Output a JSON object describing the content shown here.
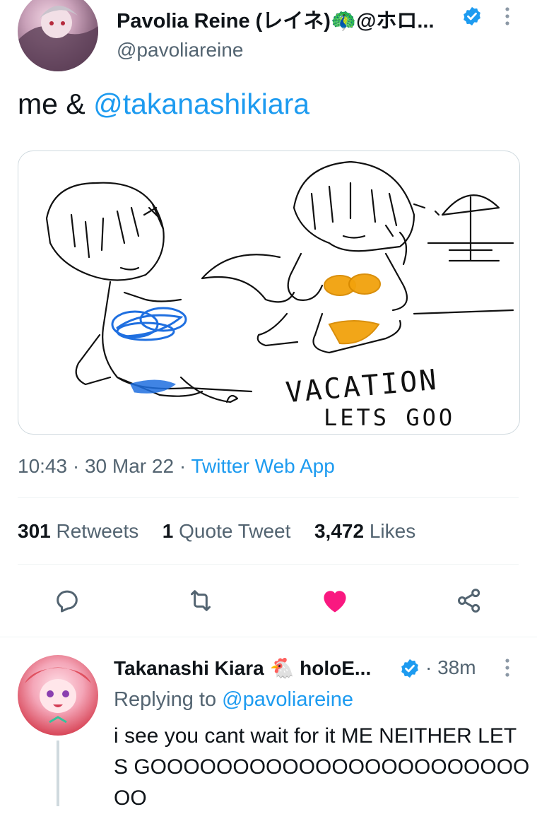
{
  "tweet": {
    "author_name": "Pavolia Reine (レイネ)🦚@ホロ...",
    "author_handle": "@pavoliareine",
    "text_prefix": "me & ",
    "mention": "@takanashikiara",
    "image_text_1": "VACATION",
    "image_text_2": "LETS GOO",
    "time": "10:43",
    "date": "30 Mar 22",
    "source": "Twitter Web App",
    "retweets_count": "301",
    "retweets_label": "Retweets",
    "quotes_count": "1",
    "quotes_label": "Quote Tweet",
    "likes_count": "3,472",
    "likes_label": "Likes"
  },
  "reply": {
    "author_name": "Takanashi Kiara 🐔 holoE...",
    "time_ago": "38m",
    "replying_prefix": "Replying to ",
    "replying_to": "@pavoliareine",
    "text": "i see you cant wait for it ME NEITHER LETS GOOOOOOOOOOOOOOOOOOOOOOOOO"
  },
  "colors": {
    "accent": "#1d9bf0",
    "like": "#f91880",
    "muted": "#536471",
    "text": "#0f1419"
  },
  "icons": [
    "verified-badge-icon",
    "more-icon",
    "reply-icon",
    "retweet-icon",
    "like-icon",
    "share-icon"
  ]
}
